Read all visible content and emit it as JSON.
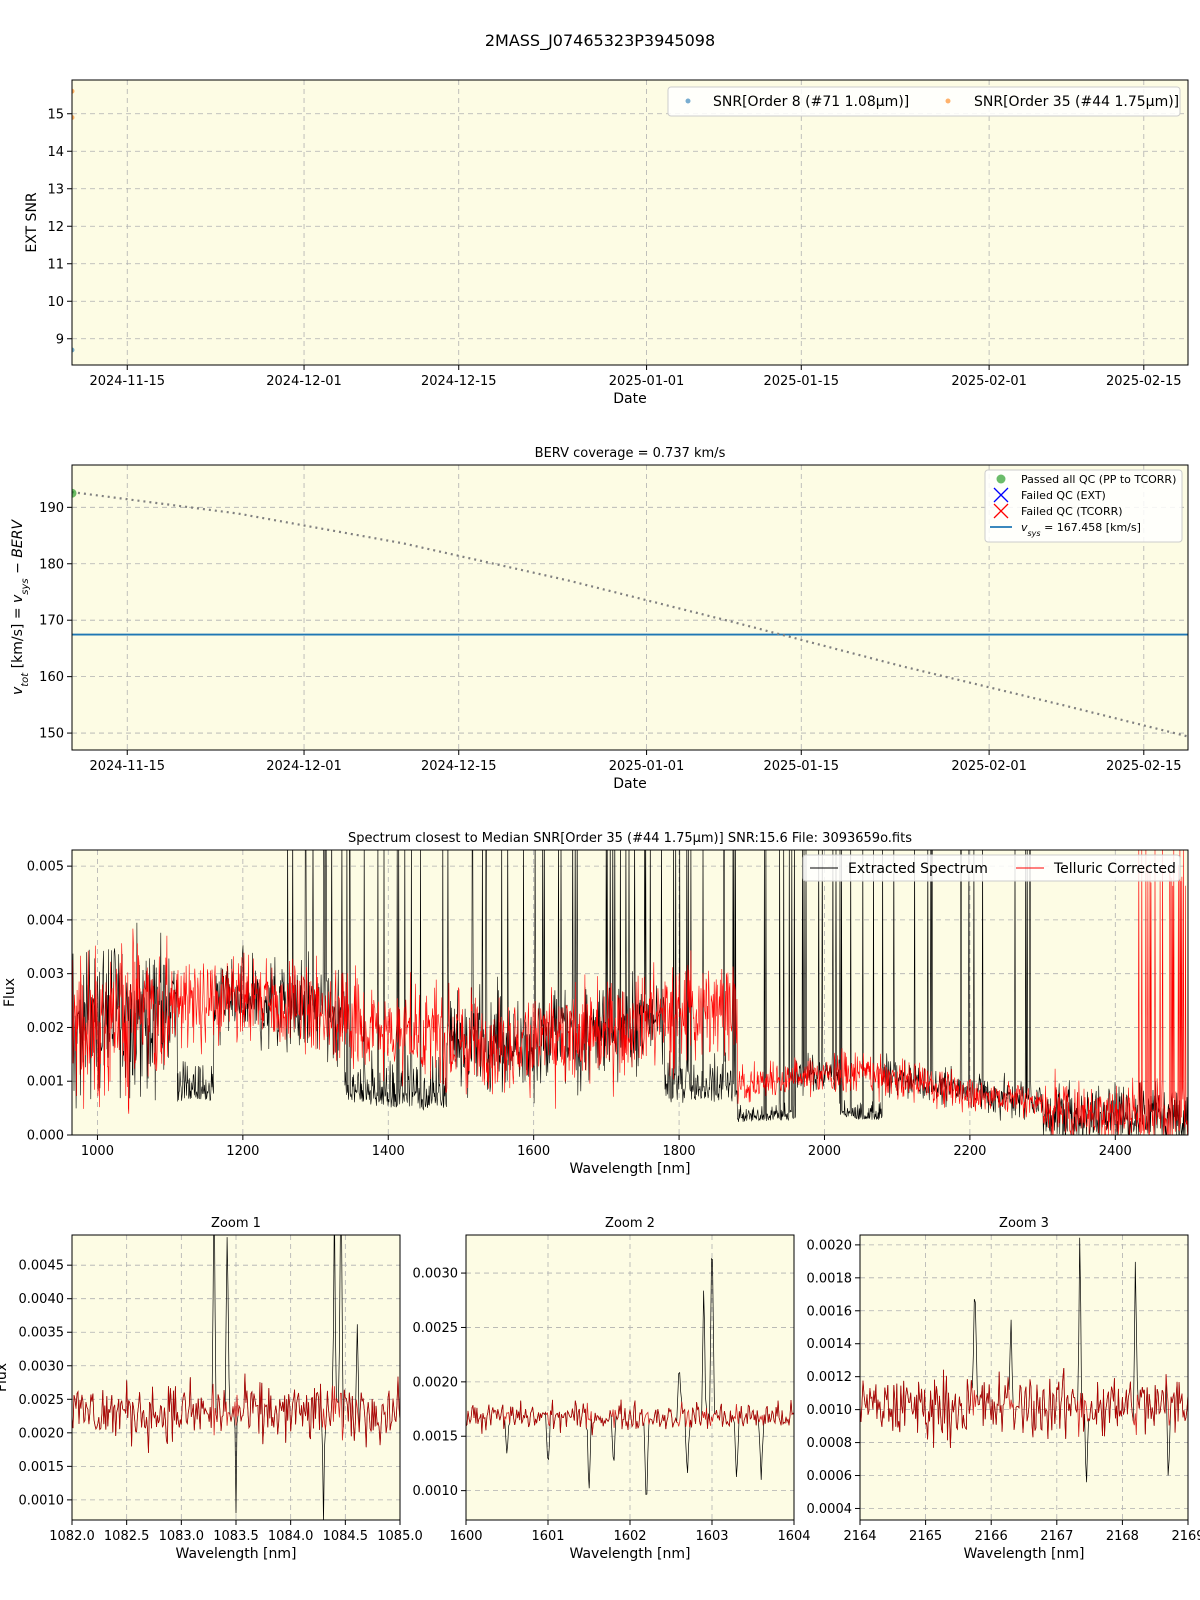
{
  "figure": {
    "title": "2MASS_J07465323P3945098"
  },
  "colors": {
    "background": "#fdfce4",
    "snr_order8": "#1f77b4",
    "snr_order35": "#ff7f0e",
    "passed_qc": "#2ca02c",
    "failed_ext": "#0000ff",
    "failed_tcorr": "#ff0000",
    "vsys_line": "#1f77b4",
    "berv_curve": "#808080",
    "extracted": "#000000",
    "telluric": "#ff0000"
  },
  "chart_data": [
    {
      "id": "snr",
      "type": "scatter",
      "title": "",
      "xlabel": "Date",
      "ylabel": "EXT SNR",
      "x_axis": "date",
      "xlim": [
        "2024-11-10",
        "2025-02-19"
      ],
      "ylim": [
        8.3,
        15.9
      ],
      "xticks": [
        "2024-11-15",
        "2024-12-01",
        "2024-12-15",
        "2025-01-01",
        "2025-01-15",
        "2025-02-01",
        "2025-02-15"
      ],
      "yticks": [
        9,
        10,
        11,
        12,
        13,
        14,
        15
      ],
      "grid": true,
      "legend": "top-right",
      "series": [
        {
          "name": "SNR[Order 8 (#71 1.08μm)]",
          "color": "#1f77b4",
          "points": [
            [
              "2024-11-10",
              8.7
            ]
          ]
        },
        {
          "name": "SNR[Order 35 (#44 1.75μm)]",
          "color": "#ff7f0e",
          "points": [
            [
              "2024-11-10",
              15.6
            ],
            [
              "2024-11-10",
              14.9
            ]
          ]
        }
      ]
    },
    {
      "id": "berv",
      "type": "scatter",
      "title": "BERV coverage = 0.737 km/s",
      "xlabel": "Date",
      "ylabel": "v_tot [km/s] = v_sys − BERV",
      "x_axis": "date",
      "xlim": [
        "2024-11-10",
        "2025-02-19"
      ],
      "ylim": [
        147,
        197.5
      ],
      "xticks": [
        "2024-11-15",
        "2024-12-01",
        "2024-12-15",
        "2025-01-01",
        "2025-01-15",
        "2025-02-01",
        "2025-02-15"
      ],
      "yticks": [
        150,
        160,
        170,
        180,
        190
      ],
      "grid": true,
      "legend": "top-right",
      "legend_entries": [
        "Passed all QC (PP to TCORR)",
        "Failed QC (EXT)",
        "Failed QC (TCORR)",
        "v_sys = 167.458 [km/s]"
      ],
      "vsys": 167.458,
      "passed_points": [
        [
          "2024-11-10",
          192.5
        ]
      ],
      "berv_curve": [
        [
          "2024-11-10",
          192.7
        ],
        [
          "2024-11-25",
          188.9
        ],
        [
          "2024-12-10",
          183.6
        ],
        [
          "2024-12-25",
          177.0
        ],
        [
          "2025-01-09",
          169.6
        ],
        [
          "2025-01-24",
          161.9
        ],
        [
          "2025-02-08",
          154.8
        ],
        [
          "2025-02-19",
          149.4
        ]
      ]
    },
    {
      "id": "spectrum",
      "type": "line",
      "title": "Spectrum closest to Median SNR[Order 35 (#44 1.75μm)]     SNR:15.6     File: 3093659o.fits",
      "xlabel": "Wavelength [nm]",
      "ylabel": "Flux",
      "xlim": [
        965,
        2500
      ],
      "ylim": [
        0,
        0.0053
      ],
      "xticks": [
        1000,
        1200,
        1400,
        1600,
        1800,
        2000,
        2200,
        2400
      ],
      "yticks": [
        "0.000",
        "0.001",
        "0.002",
        "0.003",
        "0.004",
        "0.005"
      ],
      "grid": true,
      "legend": "top-right",
      "series": [
        {
          "name": "Extracted Spectrum",
          "color": "#000000"
        },
        {
          "name": "Telluric Corrected",
          "color": "#ff0000"
        }
      ]
    },
    {
      "id": "zoom1",
      "type": "line",
      "title": "Zoom 1",
      "xlabel": "Wavelength [nm]",
      "ylabel": "Flux",
      "xlim": [
        1082.0,
        1085.0
      ],
      "ylim": [
        0.0007,
        0.00495
      ],
      "xticks": [
        "1082.0",
        "1082.5",
        "1083.0",
        "1083.5",
        "1084.0",
        "1084.5",
        "1085.0"
      ],
      "yticks": [
        "0.0010",
        "0.0015",
        "0.0020",
        "0.0025",
        "0.0030",
        "0.0035",
        "0.0040",
        "0.0045"
      ],
      "grid": true
    },
    {
      "id": "zoom2",
      "type": "line",
      "title": "Zoom 2",
      "xlabel": "Wavelength [nm]",
      "ylabel": "",
      "xlim": [
        1600,
        1604
      ],
      "ylim": [
        0.00073,
        0.00335
      ],
      "xticks": [
        "1600",
        "1601",
        "1602",
        "1603",
        "1604"
      ],
      "yticks": [
        "0.0010",
        "0.0015",
        "0.0020",
        "0.0025",
        "0.0030"
      ],
      "grid": true
    },
    {
      "id": "zoom3",
      "type": "line",
      "title": "Zoom 3",
      "xlabel": "Wavelength [nm]",
      "ylabel": "",
      "xlim": [
        2164,
        2169
      ],
      "ylim": [
        0.00033,
        0.00206
      ],
      "xticks": [
        "2164",
        "2165",
        "2166",
        "2167",
        "2168",
        "2169"
      ],
      "yticks": [
        "0.0004",
        "0.0006",
        "0.0008",
        "0.0010",
        "0.0012",
        "0.0014",
        "0.0016",
        "0.0018",
        "0.0020"
      ],
      "grid": true
    }
  ]
}
